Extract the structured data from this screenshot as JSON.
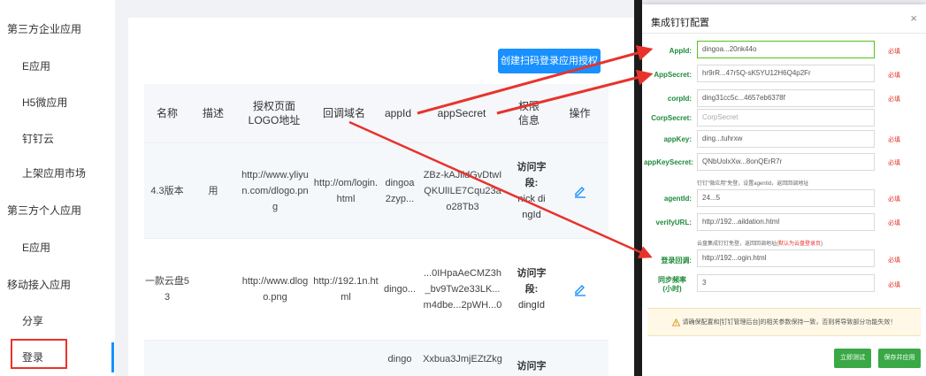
{
  "sidebar": {
    "groups": [
      {
        "label": "第三方企业应用"
      },
      {
        "label": "第三方个人应用"
      },
      {
        "label": "移动接入应用"
      }
    ],
    "items": [
      {
        "label": "E应用"
      },
      {
        "label": "H5微应用"
      },
      {
        "label": "钉钉云"
      },
      {
        "label": "上架应用市场"
      },
      {
        "label": "E应用"
      },
      {
        "label": "分享"
      },
      {
        "label": "登录"
      }
    ]
  },
  "main": {
    "create_button": "创建扫码登录应用授权",
    "columns": [
      "名称",
      "描述",
      "授权页面LOGO地址",
      "回调域名",
      "appId",
      "appSecret",
      "权限信息",
      "操作"
    ],
    "rows": [
      {
        "name": "4.3版本",
        "desc": "用",
        "logo": "http://www.yliyun.com/dlogo.png",
        "callback": "http://om/login.html",
        "appid": "dingoa2zyp...",
        "secret": "ZBz-kAJildGvDtwIQKUlILE7Cqu23ao28Tb3",
        "perm_title": "访问字段:",
        "perm_value": "nick dingId"
      },
      {
        "name": "一款云盘53",
        "desc": "",
        "logo": "http://www.dlogo.png",
        "callback": "http://192.1n.html",
        "appid": "dingo...",
        "secret": "...0IHpaAeCMZ3h_bv9Tw2e33LK...m4dbe...2pWH...0",
        "perm_title": "访问字段:",
        "perm_value": "dingId"
      },
      {
        "name": "",
        "desc": "",
        "logo": "",
        "callback": "",
        "appid": "dingo",
        "secret": "Xxbua3JmjEZtZkg",
        "perm_title": "访问字",
        "perm_value": ""
      }
    ]
  },
  "modal": {
    "title": "集成钉钉配置",
    "close": "×",
    "fields": [
      {
        "label": "AppId:",
        "value": "dingoa...20nk44o",
        "required": "必填"
      },
      {
        "label": "AppSecret:",
        "value": "hr9rR...47r5Q-sK5YU12H6Q4p2Fr",
        "required": "必填"
      },
      {
        "label": "corpId:",
        "value": "ding31cc5c...4657eb6378f",
        "required": "必填"
      },
      {
        "label": "CorpSecret:",
        "value": "CorpSecret",
        "required": ""
      },
      {
        "label": "appKey:",
        "value": "ding...tuhrxw",
        "required": "必填"
      },
      {
        "label": "appKeySecret:",
        "value": "QNbUolxXw...8onQErR7r",
        "required": "必填"
      },
      {
        "label": "agentId:",
        "value": "24...5",
        "required": "必填"
      },
      {
        "label": "verifyURL:",
        "value": "http://192...aildation.html",
        "required": "必填"
      },
      {
        "label": "登录回调:",
        "value": "http://192...ogin.html",
        "required": "必填"
      },
      {
        "label": "同步频率(小时)",
        "value": "3",
        "required": "必填"
      }
    ],
    "hint_agent": "钉钉\"微应用\"免登，设置agentId，返回回调地址",
    "hint_login_prefix": "云盘集成钉钉免登，返回回调地址(",
    "hint_login_link": "默认为云盘登录页",
    "hint_login_suffix": ")",
    "warning": "请确保配置和[钉钉管理后台]的相关参数保持一致，否则将导致部分功能失效！",
    "test_button": "立即测试",
    "save_button": "保存并应用"
  },
  "colors": {
    "primary": "#1890ff",
    "arrow": "#e8332c",
    "label_green": "#1e8a3a",
    "button_green": "#39a845"
  }
}
